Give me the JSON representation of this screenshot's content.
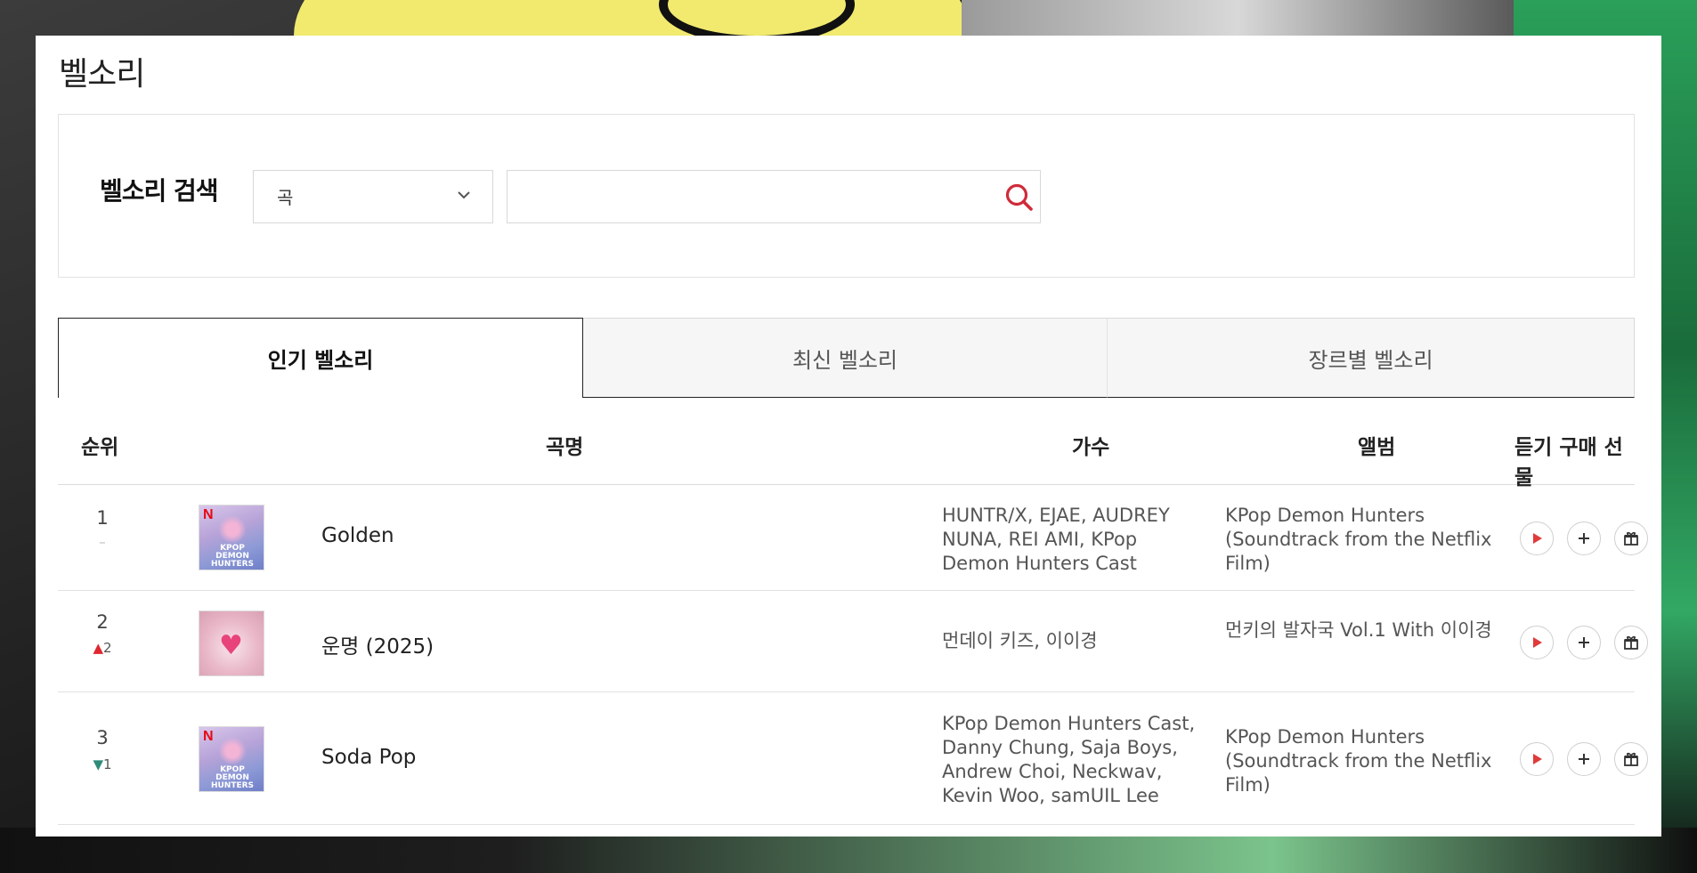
{
  "page": {
    "title": "벨소리"
  },
  "search": {
    "label": "벨소리 검색",
    "select_value": "곡",
    "input_value": "",
    "placeholder": ""
  },
  "tabs": [
    {
      "label": "인기 벨소리",
      "active": true
    },
    {
      "label": "최신 벨소리",
      "active": false
    },
    {
      "label": "장르별 벨소리",
      "active": false
    }
  ],
  "table": {
    "headers": {
      "rank": "순위",
      "title": "곡명",
      "artist": "가수",
      "album": "앨범",
      "actions": "듣기 구매 선물"
    },
    "rows": [
      {
        "rank": "1",
        "change_type": "same",
        "change_symbol": "–",
        "change_value": "",
        "title": "Golden",
        "artist": "HUNTR/X, EJAE, AUDREY NUNA, REI AMI, KPop Demon Hunters Cast",
        "album": "KPop Demon Hunters (Soundtrack from the Netflix Film)",
        "cover": "kpop"
      },
      {
        "rank": "2",
        "change_type": "up",
        "change_symbol": "🠅",
        "change_value": "2",
        "title": "운명 (2025)",
        "artist": "먼데이 키즈, 이이경",
        "album": "먼키의 발자국 Vol.1 With 이이경",
        "cover": "pink"
      },
      {
        "rank": "3",
        "change_type": "down",
        "change_symbol": "🠇",
        "change_value": "1",
        "title": "Soda Pop",
        "artist": "KPop Demon Hunters Cast, Danny Chung, Saja Boys, Andrew Choi, Neckwav, Kevin Woo, samUIL Lee",
        "album": "KPop Demon Hunters (Soundtrack from the Netflix Film)",
        "cover": "kpop"
      }
    ]
  },
  "colors": {
    "accent": "#e0262f",
    "down": "#2e8b7a",
    "text": "#222222"
  }
}
